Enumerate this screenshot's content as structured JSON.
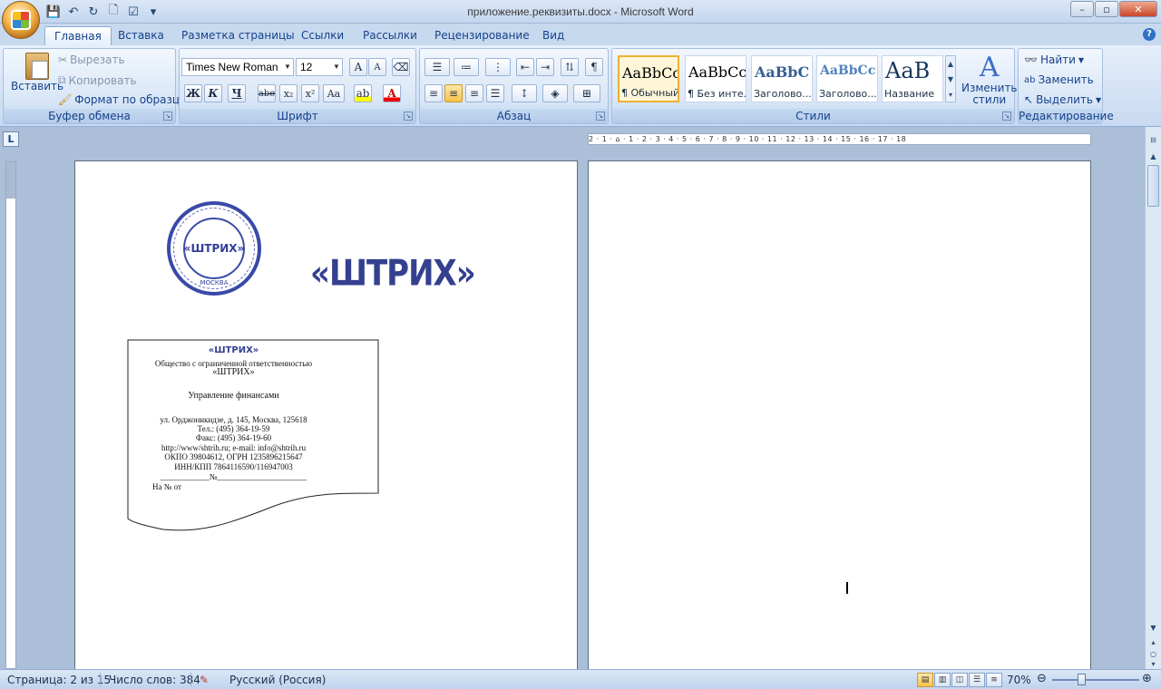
{
  "window": {
    "title": "приложение.реквизиты.docx - Microsoft Word",
    "min": "–",
    "max": "▫",
    "close": "✕"
  },
  "qat": {
    "save_icon": "save-icon",
    "undo_icon": "undo-icon",
    "redo_icon": "redo-icon",
    "print_icon": "print-preview-icon",
    "customize_icon": "customize-icon"
  },
  "tabs": [
    {
      "label": "Главная",
      "active": true
    },
    {
      "label": "Вставка"
    },
    {
      "label": "Разметка страницы"
    },
    {
      "label": "Ссылки"
    },
    {
      "label": "Рассылки"
    },
    {
      "label": "Рецензирование"
    },
    {
      "label": "Вид"
    }
  ],
  "ribbon": {
    "clipboard": {
      "label": "Буфер обмена",
      "paste": "Вставить",
      "cut": "Вырезать",
      "copy": "Копировать",
      "format_painter": "Формат по образцу"
    },
    "font": {
      "label": "Шрифт",
      "family": "Times New Roman",
      "size": "12",
      "grow": "A",
      "shrink": "A",
      "bold": "Ж",
      "italic": "К",
      "underline": "Ч",
      "strike": "abe",
      "sub": "x₂",
      "sup": "x²",
      "case": "Aa"
    },
    "paragraph": {
      "label": "Абзац",
      "pilcrow": "¶"
    },
    "styles": {
      "label": "Стили",
      "items": [
        {
          "sample": "AaBbCcI",
          "name": "¶ Обычный",
          "selected": true
        },
        {
          "sample": "AaBbCcI",
          "name": "¶ Без инте..."
        },
        {
          "sample": "AaBbC",
          "name": "Заголово..."
        },
        {
          "sample": "AaBbCc",
          "name": "Заголово..."
        },
        {
          "sample": "AaB",
          "name": "Название"
        }
      ],
      "change": "Изменить",
      "change2": "стили"
    },
    "editing": {
      "label": "Редактирование",
      "find": "Найти",
      "replace": "Заменить",
      "select": "Выделить"
    }
  },
  "document": {
    "stamp_center": "«ШТРИХ»",
    "stamp_bottom": "МОСКВА",
    "logo": "«ШТРИХ»",
    "blank_lines": [
      "«ШТРИХ»",
      "Общество с ограниченной ответственностью",
      "«ШТРИХ»",
      "",
      "Управление финансами",
      "",
      "ул. Орджоникидзе, д. 145, Москва, 125618",
      "Тел.: (495) 364-19-59",
      "Факс:  (495) 364-19-60",
      "http://www/shtrih.ru; e-mail: info@shtrih.ru",
      "ОКПО 39804612, ОГРН 1235896215647",
      "ИНН/КПП 7864116590/116947003",
      "____________№______________________",
      "На №                          от"
    ]
  },
  "status": {
    "page": "Страница: 2 из 15",
    "words": "Число слов: 384",
    "lang": "Русский (Россия)",
    "zoom": "70%"
  },
  "ruler": {
    "h": "2 · 1 · ⌂ · 1 · 2 · 3 · 4 · 5 · 6 · 7 · 8 · 9 · 10 · 11 · 12 · 13 · 14 · 15 · 16 · 17 · 18"
  }
}
